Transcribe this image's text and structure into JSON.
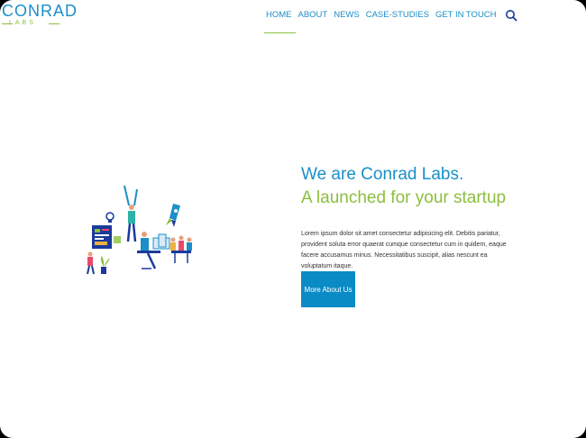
{
  "header": {
    "logo": {
      "word": "CONRAD",
      "sub": "LABS"
    },
    "nav": [
      {
        "label": "HOME",
        "active": true
      },
      {
        "label": "ABOUT",
        "active": false
      },
      {
        "label": "NEWS",
        "active": false
      },
      {
        "label": "CASE-STUDIES",
        "active": false
      },
      {
        "label": "GET IN TOUCH",
        "active": false
      }
    ],
    "search_icon": "search-icon"
  },
  "hero": {
    "title_line_1": "We are Conrad Labs.",
    "title_line_2": "A launched for your startup",
    "body": "Lorem ipsum dolor sit amet consectetur adipisicing elit. Debitis pariatur, provident soluta error quaerat cumque consectetur cum in quidem, eaque facere accusamus minus. Necessitatibus suscipit, alias nescunt ea voluptatum itaque.",
    "button_label": "More About Us",
    "illustration": "team-startup-illustration"
  },
  "colors": {
    "primary_blue": "#1a8fc8",
    "accent_green": "#8cbf3f",
    "button_blue": "#0b8bc6"
  }
}
